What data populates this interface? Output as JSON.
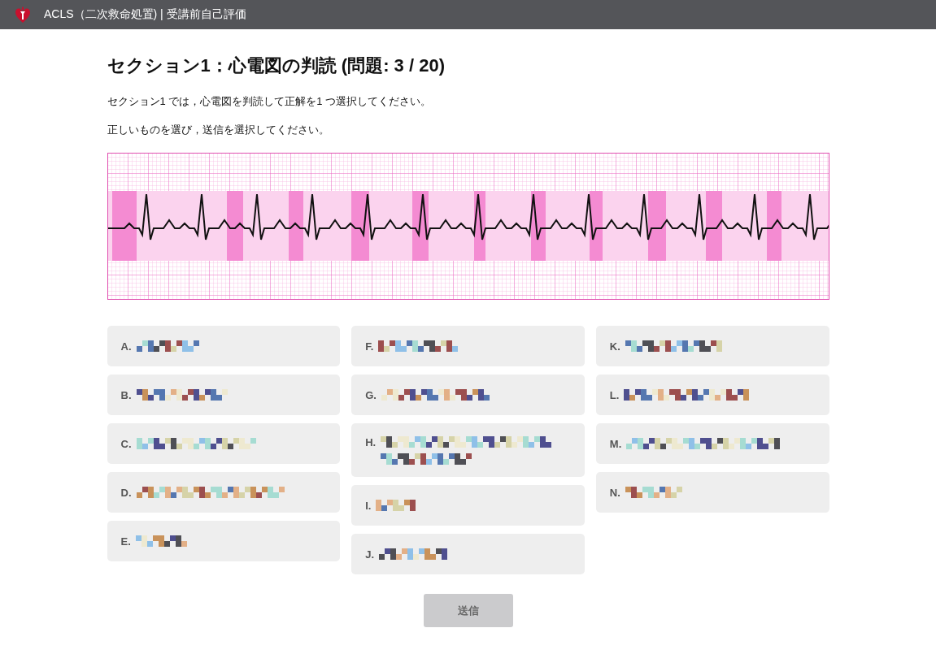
{
  "header": {
    "title": "ACLS（二次救命処置) | 受講前自己評価"
  },
  "question": {
    "heading": "セクション1：心電図の判読 (問題: 3 / 20)",
    "instructions": [
      "セクション1 では，心電図を判読して正解を1 つ選択してください。",
      "正しいものを選び，送信を選択してください。"
    ],
    "ecg": {
      "kind": "picture"
    }
  },
  "options": [
    [
      {
        "label": "A.",
        "kind": "one_line",
        "selected": false
      },
      {
        "label": "B.",
        "kind": "one_line",
        "selected": false
      },
      {
        "label": "C.",
        "kind": "one_line",
        "selected": false
      },
      {
        "label": "D.",
        "kind": "one_line",
        "selected": false
      },
      {
        "label": "E.",
        "kind": "one_line",
        "selected": false
      }
    ],
    [
      {
        "label": "F.",
        "kind": "one_line",
        "selected": false
      },
      {
        "label": "G.",
        "kind": "one_line",
        "selected": false
      },
      {
        "label": "H.",
        "kind": "two_line",
        "selected": false
      },
      {
        "label": "I.",
        "kind": "one_line",
        "selected": false
      },
      {
        "label": "J.",
        "kind": "one_line",
        "selected": false
      }
    ],
    [
      {
        "label": "K.",
        "kind": "one_line",
        "selected": false
      },
      {
        "label": "L.",
        "kind": "one_line",
        "selected": false
      },
      {
        "label": "M.",
        "kind": "one_line",
        "selected": false
      },
      {
        "label": "N.",
        "kind": "one_line",
        "selected": false
      }
    ]
  ],
  "submit": {
    "label": "送信",
    "disabled": true
  }
}
